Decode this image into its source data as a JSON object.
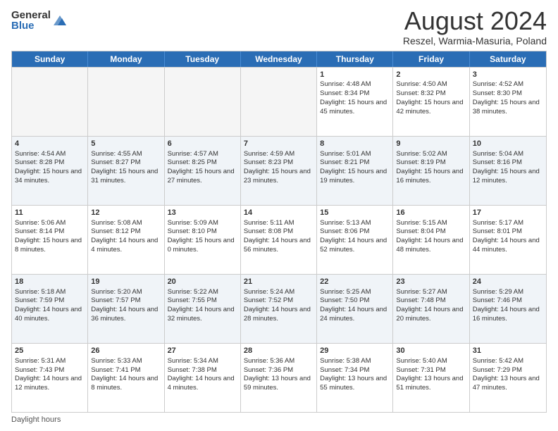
{
  "logo": {
    "general": "General",
    "blue": "Blue"
  },
  "title": "August 2024",
  "subtitle": "Reszel, Warmia-Masuria, Poland",
  "days": [
    "Sunday",
    "Monday",
    "Tuesday",
    "Wednesday",
    "Thursday",
    "Friday",
    "Saturday"
  ],
  "footer": "Daylight hours",
  "weeks": [
    [
      {
        "num": "",
        "info": ""
      },
      {
        "num": "",
        "info": ""
      },
      {
        "num": "",
        "info": ""
      },
      {
        "num": "",
        "info": ""
      },
      {
        "num": "1",
        "info": "Sunrise: 4:48 AM\nSunset: 8:34 PM\nDaylight: 15 hours and 45 minutes."
      },
      {
        "num": "2",
        "info": "Sunrise: 4:50 AM\nSunset: 8:32 PM\nDaylight: 15 hours and 42 minutes."
      },
      {
        "num": "3",
        "info": "Sunrise: 4:52 AM\nSunset: 8:30 PM\nDaylight: 15 hours and 38 minutes."
      }
    ],
    [
      {
        "num": "4",
        "info": "Sunrise: 4:54 AM\nSunset: 8:28 PM\nDaylight: 15 hours and 34 minutes."
      },
      {
        "num": "5",
        "info": "Sunrise: 4:55 AM\nSunset: 8:27 PM\nDaylight: 15 hours and 31 minutes."
      },
      {
        "num": "6",
        "info": "Sunrise: 4:57 AM\nSunset: 8:25 PM\nDaylight: 15 hours and 27 minutes."
      },
      {
        "num": "7",
        "info": "Sunrise: 4:59 AM\nSunset: 8:23 PM\nDaylight: 15 hours and 23 minutes."
      },
      {
        "num": "8",
        "info": "Sunrise: 5:01 AM\nSunset: 8:21 PM\nDaylight: 15 hours and 19 minutes."
      },
      {
        "num": "9",
        "info": "Sunrise: 5:02 AM\nSunset: 8:19 PM\nDaylight: 15 hours and 16 minutes."
      },
      {
        "num": "10",
        "info": "Sunrise: 5:04 AM\nSunset: 8:16 PM\nDaylight: 15 hours and 12 minutes."
      }
    ],
    [
      {
        "num": "11",
        "info": "Sunrise: 5:06 AM\nSunset: 8:14 PM\nDaylight: 15 hours and 8 minutes."
      },
      {
        "num": "12",
        "info": "Sunrise: 5:08 AM\nSunset: 8:12 PM\nDaylight: 14 hours and 4 minutes."
      },
      {
        "num": "13",
        "info": "Sunrise: 5:09 AM\nSunset: 8:10 PM\nDaylight: 15 hours and 0 minutes."
      },
      {
        "num": "14",
        "info": "Sunrise: 5:11 AM\nSunset: 8:08 PM\nDaylight: 14 hours and 56 minutes."
      },
      {
        "num": "15",
        "info": "Sunrise: 5:13 AM\nSunset: 8:06 PM\nDaylight: 14 hours and 52 minutes."
      },
      {
        "num": "16",
        "info": "Sunrise: 5:15 AM\nSunset: 8:04 PM\nDaylight: 14 hours and 48 minutes."
      },
      {
        "num": "17",
        "info": "Sunrise: 5:17 AM\nSunset: 8:01 PM\nDaylight: 14 hours and 44 minutes."
      }
    ],
    [
      {
        "num": "18",
        "info": "Sunrise: 5:18 AM\nSunset: 7:59 PM\nDaylight: 14 hours and 40 minutes."
      },
      {
        "num": "19",
        "info": "Sunrise: 5:20 AM\nSunset: 7:57 PM\nDaylight: 14 hours and 36 minutes."
      },
      {
        "num": "20",
        "info": "Sunrise: 5:22 AM\nSunset: 7:55 PM\nDaylight: 14 hours and 32 minutes."
      },
      {
        "num": "21",
        "info": "Sunrise: 5:24 AM\nSunset: 7:52 PM\nDaylight: 14 hours and 28 minutes."
      },
      {
        "num": "22",
        "info": "Sunrise: 5:25 AM\nSunset: 7:50 PM\nDaylight: 14 hours and 24 minutes."
      },
      {
        "num": "23",
        "info": "Sunrise: 5:27 AM\nSunset: 7:48 PM\nDaylight: 14 hours and 20 minutes."
      },
      {
        "num": "24",
        "info": "Sunrise: 5:29 AM\nSunset: 7:46 PM\nDaylight: 14 hours and 16 minutes."
      }
    ],
    [
      {
        "num": "25",
        "info": "Sunrise: 5:31 AM\nSunset: 7:43 PM\nDaylight: 14 hours and 12 minutes."
      },
      {
        "num": "26",
        "info": "Sunrise: 5:33 AM\nSunset: 7:41 PM\nDaylight: 14 hours and 8 minutes."
      },
      {
        "num": "27",
        "info": "Sunrise: 5:34 AM\nSunset: 7:38 PM\nDaylight: 14 hours and 4 minutes."
      },
      {
        "num": "28",
        "info": "Sunrise: 5:36 AM\nSunset: 7:36 PM\nDaylight: 13 hours and 59 minutes."
      },
      {
        "num": "29",
        "info": "Sunrise: 5:38 AM\nSunset: 7:34 PM\nDaylight: 13 hours and 55 minutes."
      },
      {
        "num": "30",
        "info": "Sunrise: 5:40 AM\nSunset: 7:31 PM\nDaylight: 13 hours and 51 minutes."
      },
      {
        "num": "31",
        "info": "Sunrise: 5:42 AM\nSunset: 7:29 PM\nDaylight: 13 hours and 47 minutes."
      }
    ]
  ]
}
